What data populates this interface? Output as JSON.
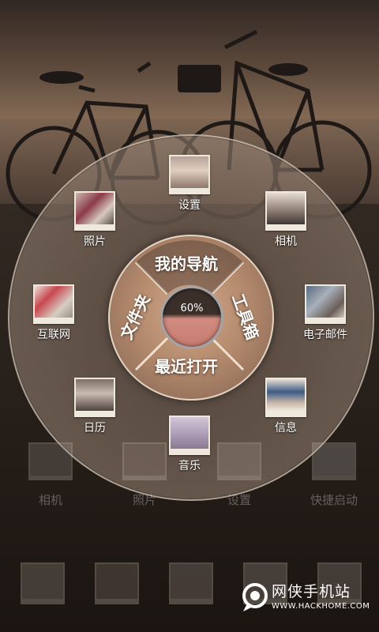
{
  "nav_wheel": {
    "top_tab": "我的导航",
    "left_tab": "文件夹",
    "right_tab": "工具箱",
    "bottom_tab": "最近打开",
    "center_value": "60%"
  },
  "apps": [
    {
      "label": "设置"
    },
    {
      "label": "照片"
    },
    {
      "label": "相机"
    },
    {
      "label": "互联网"
    },
    {
      "label": "电子邮件"
    },
    {
      "label": "日历"
    },
    {
      "label": "信息"
    },
    {
      "label": "音乐"
    }
  ],
  "dock": [
    {
      "label": "相机"
    },
    {
      "label": "照片"
    },
    {
      "label": "设置"
    },
    {
      "label": "快捷启动"
    }
  ],
  "watermark": {
    "title": "网侠手机站",
    "url": "WWW.HACKHOME.COM"
  },
  "colors": {
    "ring_border": "#efe8dc",
    "accent": "#c77c70"
  }
}
